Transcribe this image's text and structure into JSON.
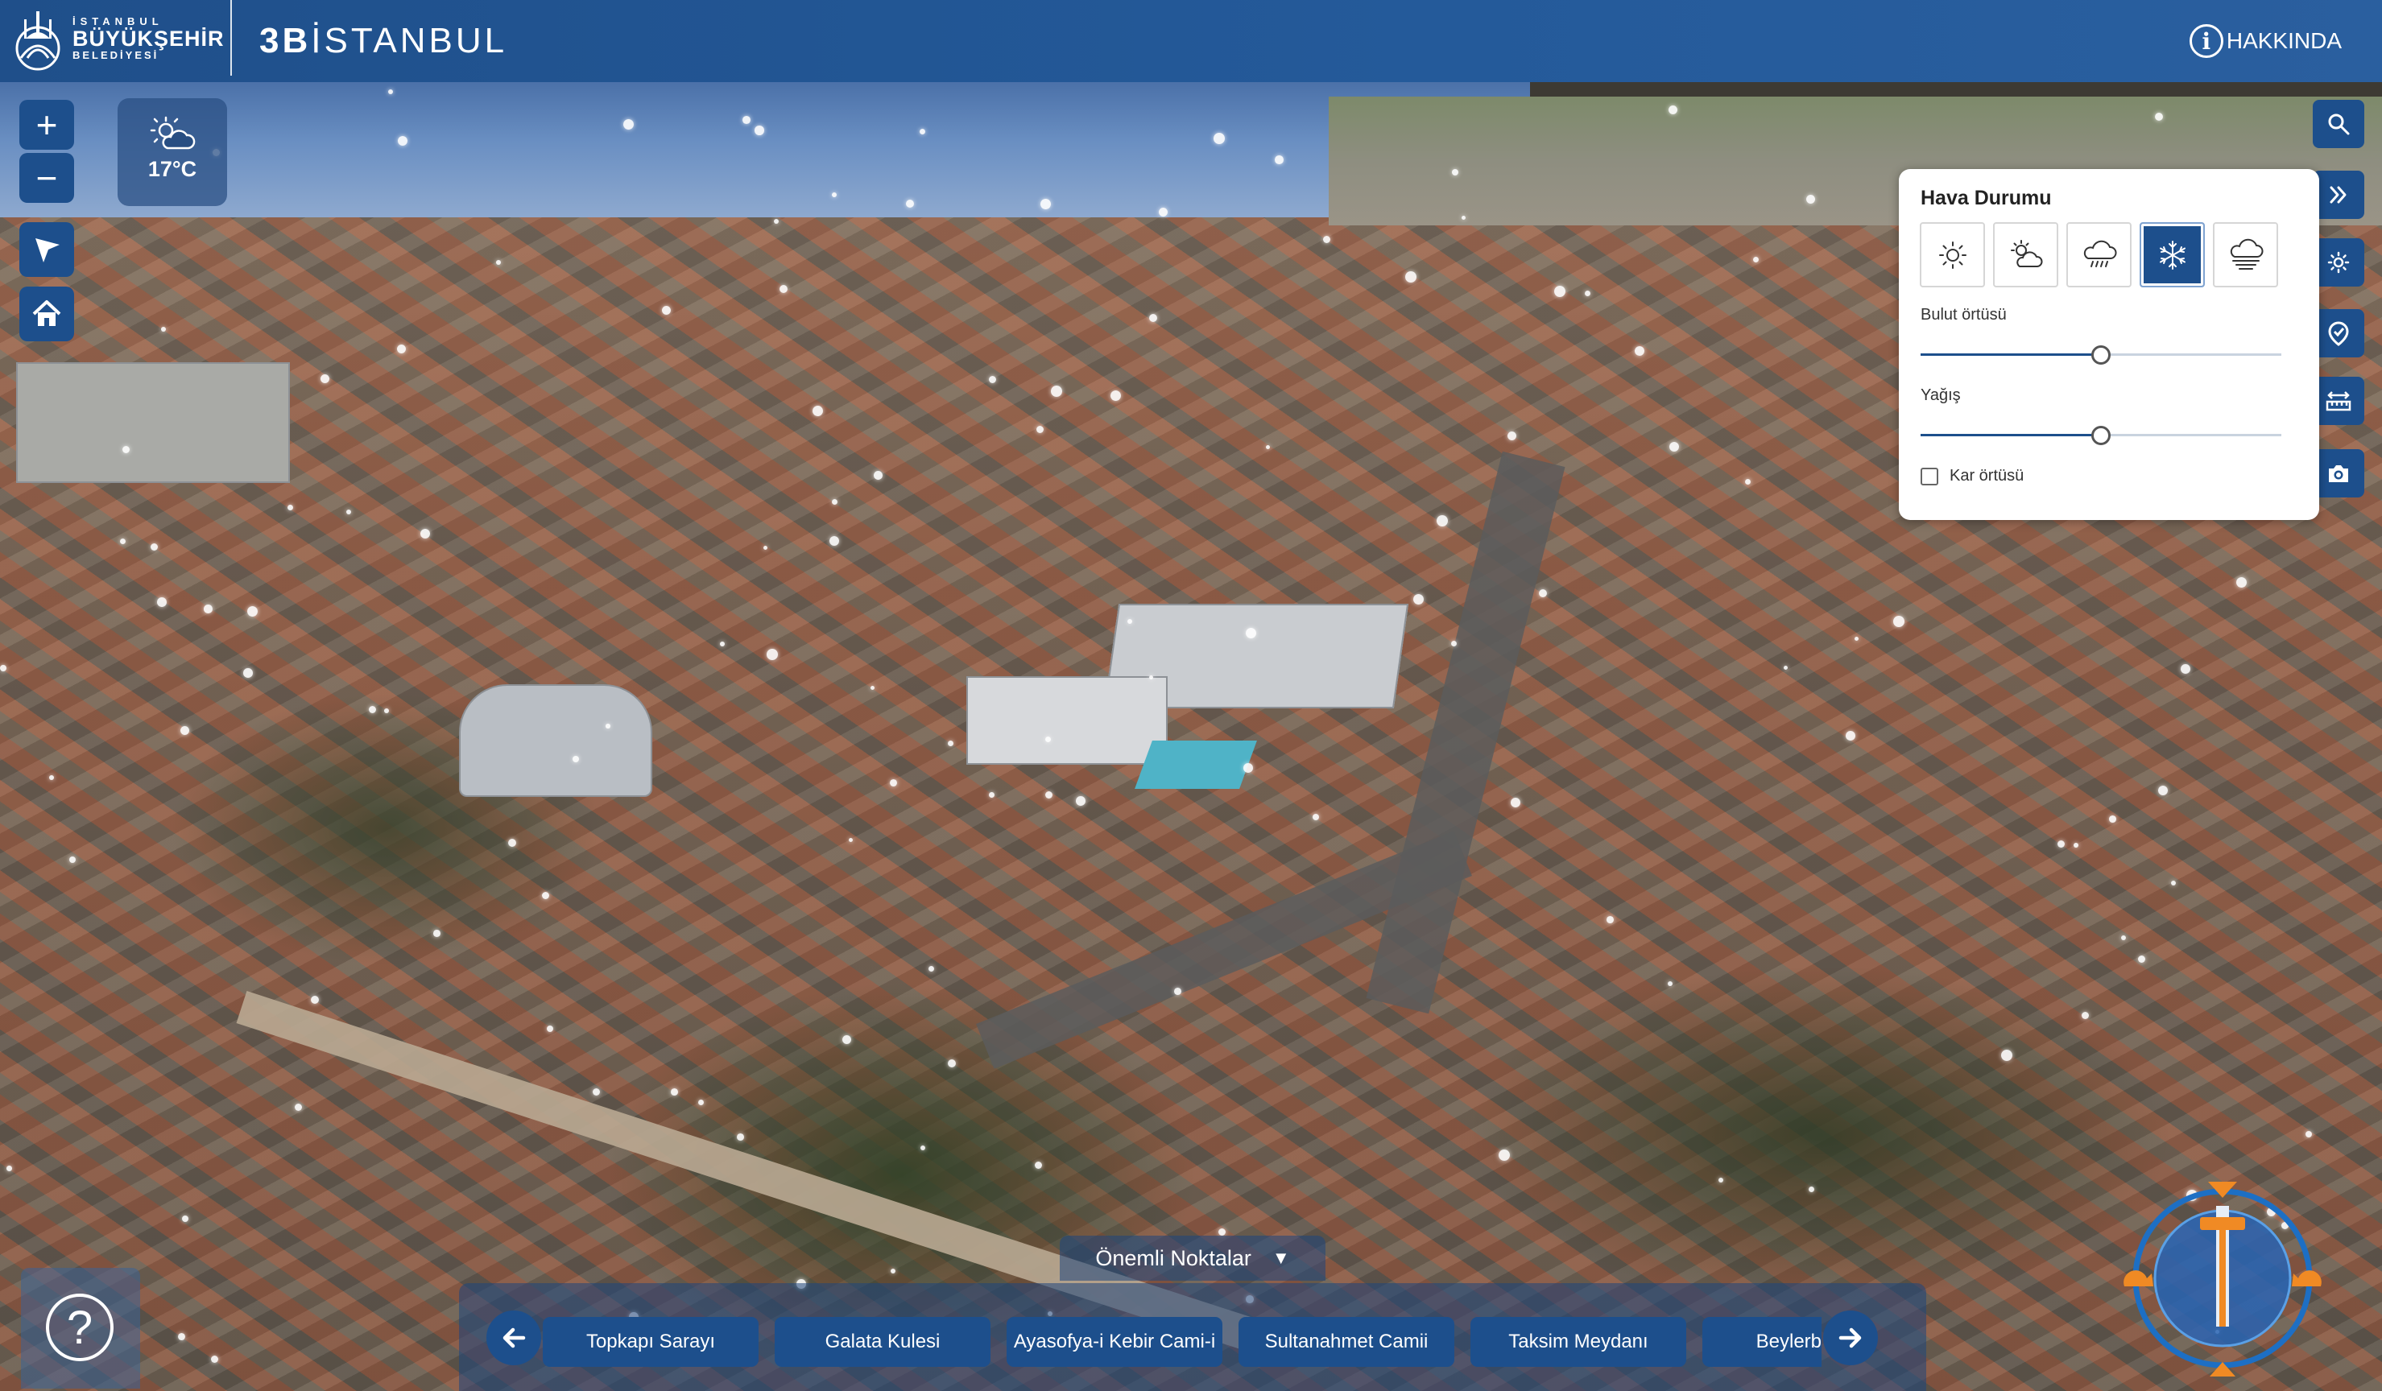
{
  "header": {
    "logo_line1": "İSTANBUL",
    "logo_line2": "BÜYÜKŞEHİR",
    "logo_line3": "BELEDİYESİ",
    "title_bold": "3B",
    "title_rest": "İSTANBUL",
    "about_label": "HAKKINDA",
    "about_icon": "i"
  },
  "map_controls": {
    "zoom_in": "+",
    "zoom_out": "−"
  },
  "weather_badge": {
    "icon": "partly-cloudy-icon",
    "temperature": "17°C"
  },
  "help": {
    "symbol": "?"
  },
  "weather_panel": {
    "title": "Hava Durumu",
    "options": [
      {
        "icon": "sun-icon",
        "active": false
      },
      {
        "icon": "partly-cloudy-icon",
        "active": false
      },
      {
        "icon": "rain-icon",
        "active": false
      },
      {
        "icon": "snow-icon",
        "active": true
      },
      {
        "icon": "fog-icon",
        "active": false
      }
    ],
    "cloud_cover_label": "Bulut örtüsü",
    "cloud_cover_value": 0.5,
    "precipitation_label": "Yağış",
    "precipitation_value": 0.5,
    "snow_cover_label": "Kar örtüsü",
    "snow_cover_checked": false
  },
  "right_toolbar": [
    "search-icon",
    "double-chevron-right-icon",
    "sun-icon",
    "map-pin-icon",
    "measure-icon",
    "camera-icon"
  ],
  "poi": {
    "toggle_label": "Önemli Noktalar",
    "toggle_caret": "▼",
    "items": [
      "Topkapı Sarayı",
      "Galata Kulesi",
      "Ayasofya-i Kebir Cami-i",
      "Sultanahmet Camii",
      "Taksim Meydanı",
      "Beylerbeyi S"
    ]
  },
  "colors": {
    "brand_blue": "#1d4f8c",
    "header_blue": "#245a9a",
    "compass_orange": "#f08a24"
  }
}
